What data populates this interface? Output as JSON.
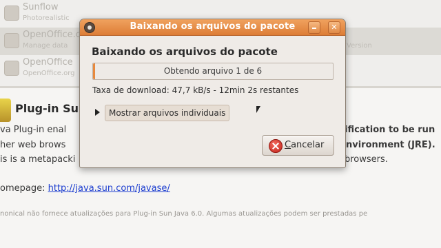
{
  "background": {
    "packages": [
      {
        "name": "Sunflow",
        "description": "Photorealistic",
        "version": ""
      },
      {
        "name": "OpenOffice.org",
        "description": "Manage data",
        "version": "Version"
      },
      {
        "name": "OpenOffice",
        "description": "OpenOffice.org",
        "version": ""
      }
    ],
    "detail": {
      "title": "Plug-in Sun",
      "line1_left": "va Plug-in enal",
      "line1_right": "ification to be run",
      "line2_left": "her web brows",
      "line2_right": "nvironment (JRE).",
      "line3_left": "is is a metapacki",
      "line3_right": "browsers.",
      "homepage_label": "omepage:",
      "homepage_url": "http://java.sun.com/javase/",
      "footnote": "nonical não fornece atualizações para Plug-in Sun Java 6.0. Algumas atualizações podem ser prestadas pe"
    }
  },
  "dialog": {
    "title": "Baixando os arquivos do pacote",
    "heading": "Baixando os arquivos do pacote",
    "progress_text": "Obtendo arquivo 1 de 6",
    "progress_fraction": 0.005,
    "rate_text": "Taxa de download: 47,7 kB/s - 12min 2s restantes",
    "expander_label": "Mostrar arquivos individuais",
    "cancel_mnemonic": "C",
    "cancel_rest": "ancelar"
  },
  "colors": {
    "titlebar": "#dd7d36",
    "progress_fill": "#e7893e",
    "link": "#1a3ccf"
  }
}
